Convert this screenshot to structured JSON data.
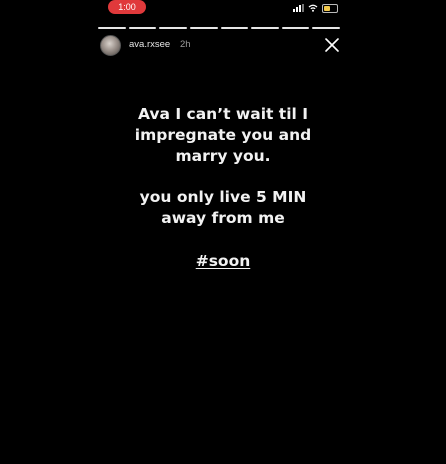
{
  "status_bar": {
    "time": "1:00",
    "time_pill_color": "#e0393b",
    "icons": [
      "signal-icon",
      "wifi-icon",
      "battery-icon"
    ],
    "battery_color": "#f2c94c"
  },
  "story": {
    "segment_count": 8,
    "viewed_segments": 8,
    "username": "ava.rxsee",
    "timestamp": "2h",
    "avatar_icon": "avatar",
    "close_icon": "close-icon",
    "message_lines_1": [
      "Ava I can’t wait til I",
      "impregnate you and",
      "marry you."
    ],
    "message_lines_2": [
      "you only live 5 MIN",
      "away from me"
    ],
    "hashtag": "#soon"
  }
}
